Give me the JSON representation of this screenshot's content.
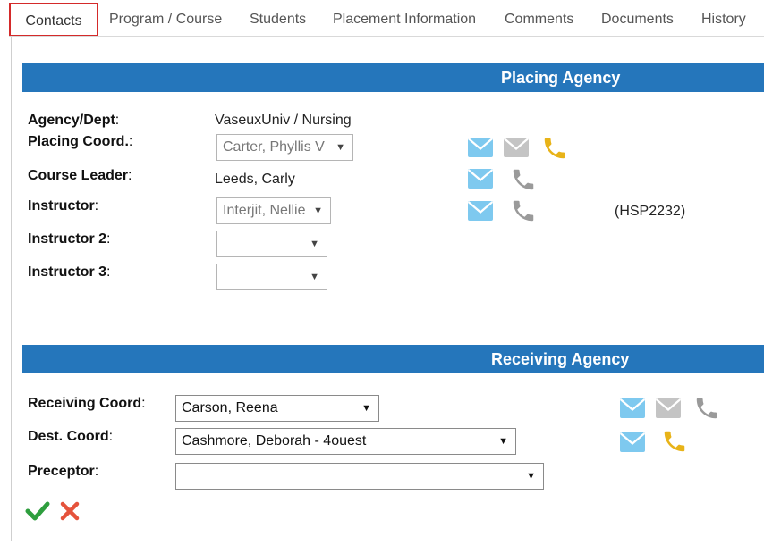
{
  "tabs": [
    {
      "label": "Contacts",
      "active": true
    },
    {
      "label": "Program / Course"
    },
    {
      "label": "Students"
    },
    {
      "label": "Placement Information"
    },
    {
      "label": "Comments"
    },
    {
      "label": "Documents"
    },
    {
      "label": "History"
    }
  ],
  "placing": {
    "header": "Placing Agency",
    "agency": {
      "label": "Agency/Dept",
      "colon": ":",
      "value": "VaseuxUniv / Nursing"
    },
    "placing_coord": {
      "label": "Placing Coord.",
      "colon": ":",
      "value": "Carter, Phyllis V"
    },
    "course_leader": {
      "label": "Course Leader",
      "colon": ":",
      "value": "Leeds, Carly"
    },
    "instructor": {
      "label": "Instructor",
      "colon": ":",
      "value": "Interjit, Nellie",
      "code": "(HSP2232)"
    },
    "instructor2": {
      "label": "Instructor 2",
      "colon": ":",
      "value": ""
    },
    "instructor3": {
      "label": "Instructor 3",
      "colon": ":",
      "value": ""
    }
  },
  "receiving": {
    "header": "Receiving Agency",
    "receiving_coord": {
      "label": "Receiving Coord",
      "colon": ":",
      "value": "Carson, Reena"
    },
    "dest_coord": {
      "label": "Dest. Coord",
      "colon": ":",
      "value": "Cashmore, Deborah - 4ouest"
    },
    "preceptor": {
      "label": "Preceptor",
      "colon": ":",
      "value": ""
    }
  },
  "dropdown_arrow": "▼",
  "icons": {
    "email": "mail-icon",
    "phone": "phone-icon",
    "save": "check-icon",
    "cancel": "close-icon"
  },
  "colors": {
    "header_band": "#2576bb",
    "active_tab_border": "#d42a2a",
    "email_active": "#7ec9ef",
    "email_disabled": "#c4c4c4",
    "phone_active": "#e8b318",
    "phone_disabled": "#9a9a9a",
    "save": "#2e9e3e",
    "cancel": "#e5533c"
  }
}
